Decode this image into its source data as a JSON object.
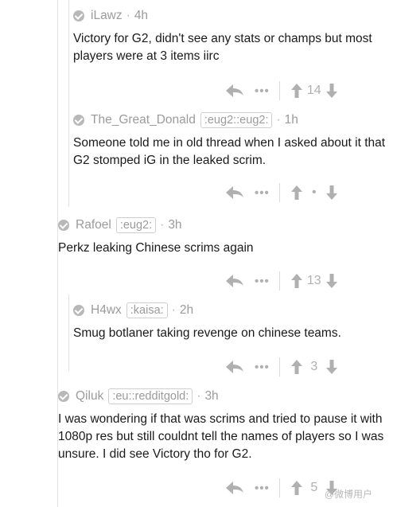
{
  "comments": [
    {
      "author": "iLawz",
      "flair": "",
      "time": "4h",
      "body": "Victory for G2, didn't see any stats or champs but most players were at 3 items iirc",
      "score": "14"
    },
    {
      "author": "The_Great_Donald",
      "flair": ":eug2::eug2:",
      "time": "1h",
      "body": "Someone told me in old thread when I asked about it that G2 stomped iG in the leaked scrim.",
      "score": "•"
    },
    {
      "author": "Rafoel",
      "flair": ":eug2:",
      "time": "3h",
      "body": "Perkz leaking Chinese scrims again",
      "score": "13"
    },
    {
      "author": "H4wx",
      "flair": ":kaisa:",
      "time": "2h",
      "body": "Smug botlaner taking revenge on chinese teams.",
      "score": "3"
    },
    {
      "author": "Qiluk",
      "flair": ":eu::redditgold:",
      "time": "3h",
      "body": "I was wondering if that was scrims and tried to pause it with 1080p res but still couldnt tell the names of players so I was unsure. I did see Victory tho for G2.",
      "score": "5"
    }
  ],
  "watermark": "@微博用户",
  "colors": {
    "meta": "#9b9b9b",
    "text": "#1a1a1a",
    "icon": "#b0b0b0",
    "rule": "#e2e2e2"
  }
}
